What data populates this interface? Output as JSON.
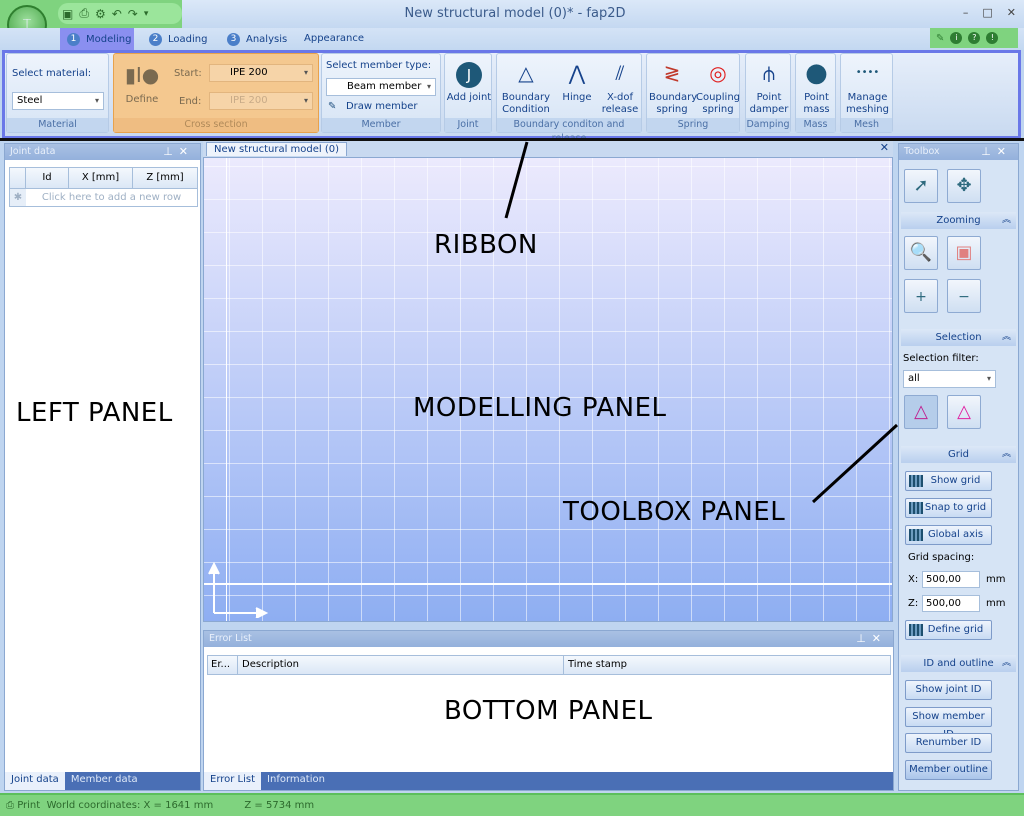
{
  "window": {
    "title": "New structural model (0)* - fap2D",
    "controls": [
      "–",
      "□",
      "✕"
    ]
  },
  "quick_access": [
    "save-icon",
    "print-icon",
    "settings-icon",
    "undo-icon",
    "redo-icon",
    "customize-icon"
  ],
  "tabs": [
    {
      "num": "1",
      "label": "Modeling"
    },
    {
      "num": "2",
      "label": "Loading"
    },
    {
      "num": "3",
      "label": "Analysis"
    },
    {
      "num": "",
      "label": "Appearance"
    }
  ],
  "ribbon": {
    "material": {
      "label": "Select material:",
      "value": "Steel",
      "group": "Material"
    },
    "cross_section": {
      "define": "Define",
      "start_label": "Start:",
      "start_value": "IPE 200",
      "end_label": "End:",
      "end_value": "IPE 200",
      "group": "Cross section"
    },
    "member": {
      "label": "Select member type:",
      "value": "Beam member",
      "draw": "Draw member",
      "group": "Member"
    },
    "joint": {
      "add": "Add joint",
      "group": "Joint"
    },
    "boundary": {
      "items": [
        "Boundary\nCondition",
        "Hinge",
        "X-dof\nrelease"
      ],
      "group": "Boundary conditon and release"
    },
    "spring": {
      "items": [
        "Boundary\nspring",
        "Coupling\nspring"
      ],
      "group": "Spring"
    },
    "damping": {
      "items": [
        "Point\ndamper"
      ],
      "group": "Damping"
    },
    "mass": {
      "items": [
        "Point\nmass"
      ],
      "group": "Mass"
    },
    "mesh": {
      "items": [
        "Manage\nmeshing"
      ],
      "group": "Mesh"
    }
  },
  "left_panel": {
    "title": "Joint data",
    "columns": [
      "Id",
      "X [mm]",
      "Z [mm]"
    ],
    "new_row": "Click here to add a new row",
    "tabs": [
      "Joint data",
      "Member data"
    ]
  },
  "document": {
    "tab": "New structural model (0)"
  },
  "bottom_panel": {
    "title": "Error List",
    "columns": [
      "Er...",
      "Description",
      "Time stamp"
    ],
    "tabs": [
      "Error List",
      "Information"
    ]
  },
  "toolbox": {
    "title": "Toolbox",
    "zooming": "Zooming",
    "selection": "Selection",
    "selection_filter_label": "Selection filter:",
    "selection_filter_value": "all",
    "grid": "Grid",
    "show_grid": "Show grid",
    "snap_to_grid": "Snap to grid",
    "global_axis": "Global axis",
    "grid_spacing": "Grid spacing:",
    "x_label": "X:",
    "x_value": "500,00",
    "z_label": "Z:",
    "z_value": "500,00",
    "unit": "mm",
    "define_grid": "Define grid",
    "id_outline": "ID and outline",
    "show_joint_id": "Show joint ID",
    "show_member_id": "Show member ID",
    "renumber_id": "Renumber ID",
    "member_outline": "Member outline"
  },
  "status": {
    "print": "Print",
    "coords_x": "World coordinates: X = 1641 mm",
    "coords_z": "Z = 5734 mm"
  },
  "annotations": {
    "ribbon": "RIBBON",
    "left": "LEFT PANEL",
    "modelling": "MODELLING PANEL",
    "toolbox": "TOOLBOX PANEL",
    "bottom": "BOTTOM PANEL"
  },
  "colors": {
    "highlight_green": "#7fd37f",
    "highlight_blue": "#6a78e8",
    "highlight_orange": "#f4c88f"
  }
}
